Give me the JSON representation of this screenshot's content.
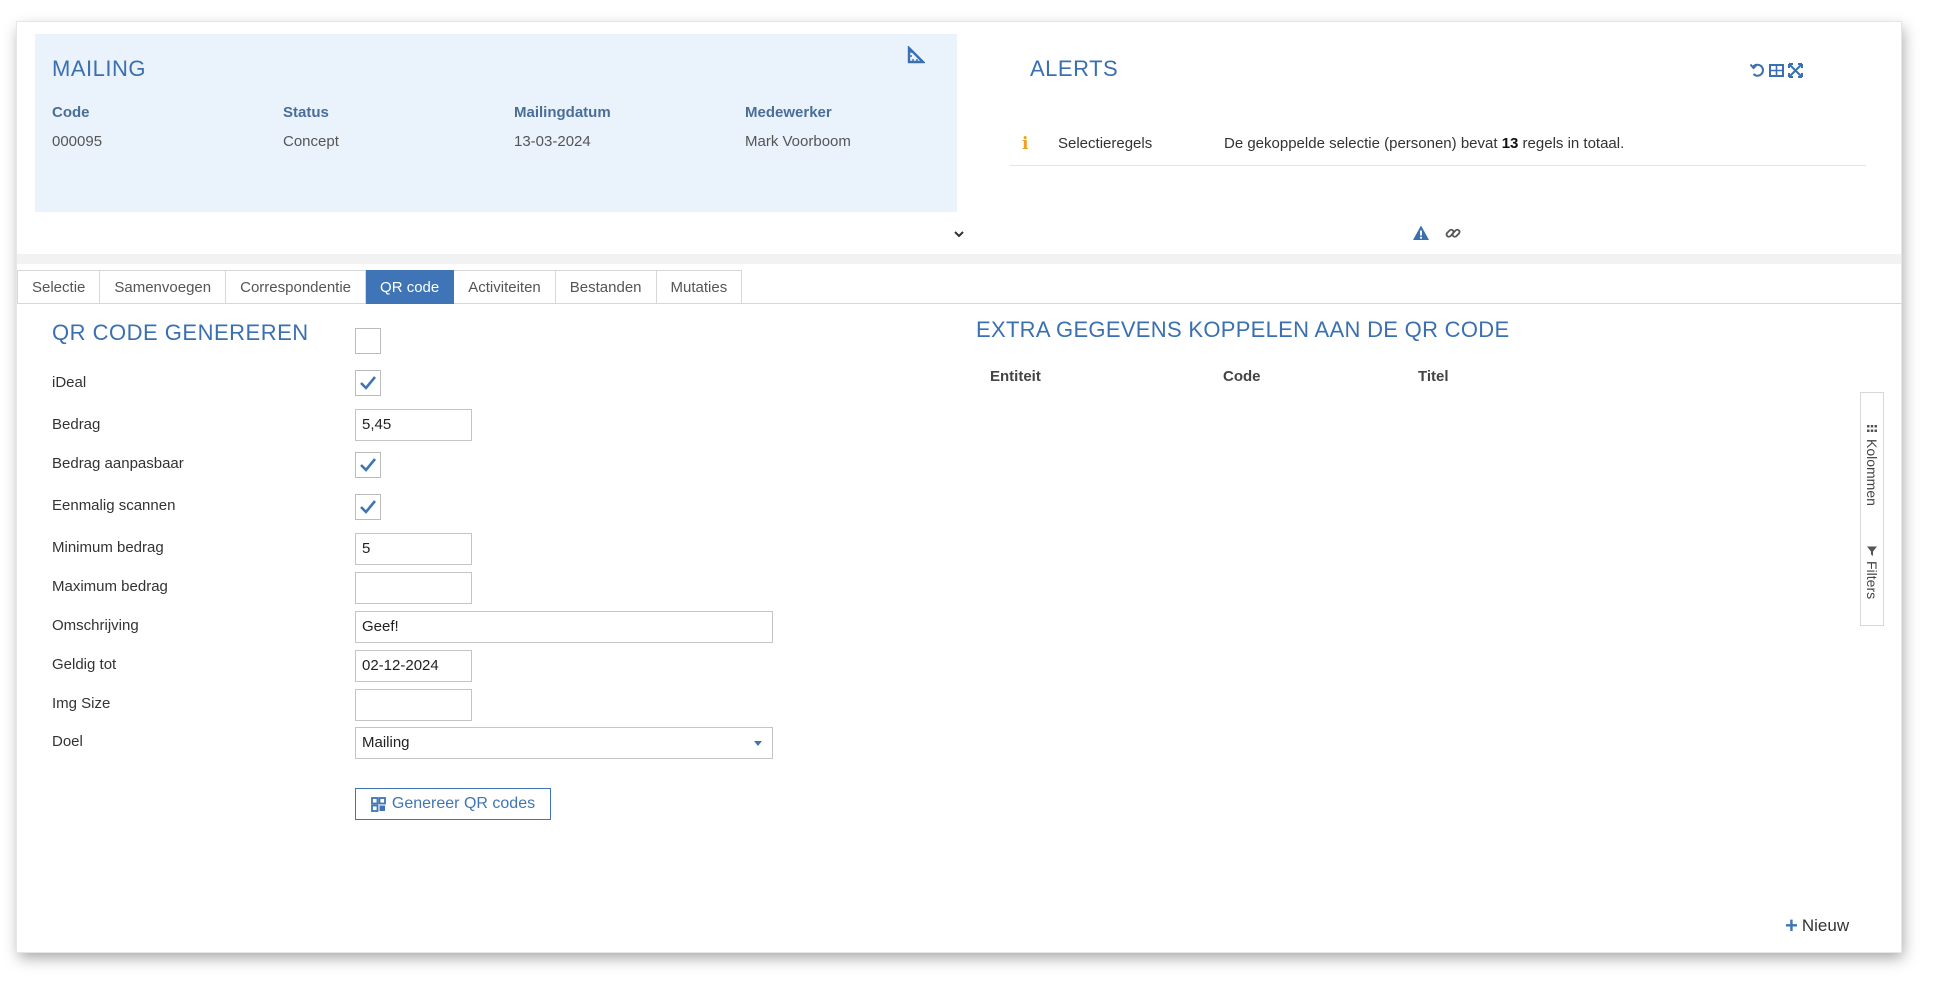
{
  "mailing": {
    "title": "MAILING",
    "fields": [
      {
        "label": "Code",
        "value": "000095"
      },
      {
        "label": "Status",
        "value": "Concept"
      },
      {
        "label": "Mailingdatum",
        "value": "13-03-2024"
      },
      {
        "label": "Medewerker",
        "value": "Mark Voorboom"
      }
    ]
  },
  "alerts": {
    "title": "ALERTS",
    "rows": [
      {
        "type": "Selectieregels",
        "message_pre": "De gekoppelde selectie (personen) bevat",
        "count": "13",
        "message_post": "regels in totaal."
      }
    ]
  },
  "tabs": [
    {
      "label": "Selectie",
      "active": false
    },
    {
      "label": "Samenvoegen",
      "active": false
    },
    {
      "label": "Correspondentie",
      "active": false
    },
    {
      "label": "QR code",
      "active": true
    },
    {
      "label": "Activiteiten",
      "active": false
    },
    {
      "label": "Bestanden",
      "active": false
    },
    {
      "label": "Mutaties",
      "active": false
    }
  ],
  "form": {
    "title": "QR CODE GENEREREN",
    "title_checked": false,
    "ideal": {
      "label": "iDeal",
      "checked": true
    },
    "bedrag": {
      "label": "Bedrag",
      "value": "5,45"
    },
    "bedrag_aanpasbaar": {
      "label": "Bedrag aanpasbaar",
      "checked": true
    },
    "eenmalig_scannen": {
      "label": "Eenmalig scannen",
      "checked": true
    },
    "minimum_bedrag": {
      "label": "Minimum bedrag",
      "value": "5"
    },
    "maximum_bedrag": {
      "label": "Maximum bedrag",
      "value": ""
    },
    "omschrijving": {
      "label": "Omschrijving",
      "value": "Geef!"
    },
    "geldig_tot": {
      "label": "Geldig tot",
      "value": "02-12-2024"
    },
    "img_size": {
      "label": "Img Size",
      "value": ""
    },
    "doel": {
      "label": "Doel",
      "value": "Mailing"
    },
    "generate_label": "Genereer QR codes"
  },
  "extra": {
    "title": "EXTRA GEGEVENS KOPPELEN AAN DE QR CODE",
    "columns": [
      "Entiteit",
      "Code",
      "Titel"
    ],
    "side_tabs": [
      "Kolommen",
      "Filters"
    ],
    "new_label": "Nieuw"
  },
  "colors": {
    "accent": "#3f75b6",
    "panel_bg": "#eaf3fc",
    "alert_icon": "#f0a020"
  }
}
